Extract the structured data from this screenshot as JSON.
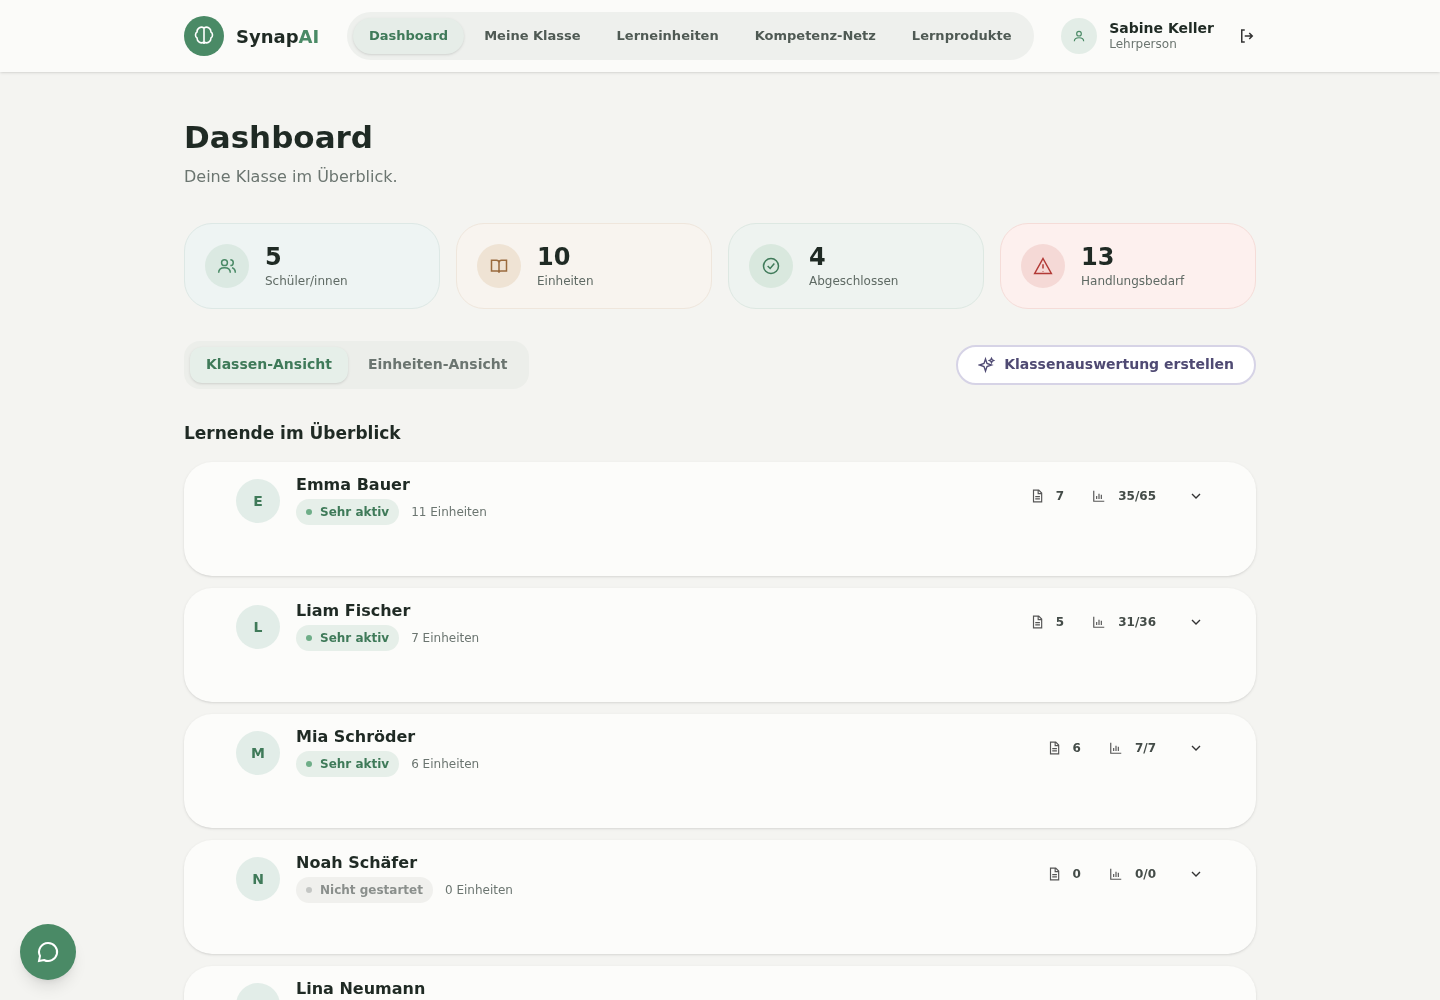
{
  "brand": {
    "name_part1": "Synap",
    "name_part2": "AI"
  },
  "nav": [
    {
      "label": "Dashboard",
      "selected": true
    },
    {
      "label": "Meine Klasse",
      "selected": false
    },
    {
      "label": "Lerneinheiten",
      "selected": false
    },
    {
      "label": "Kompetenz-Netz",
      "selected": false
    },
    {
      "label": "Lernprodukte",
      "selected": false
    }
  ],
  "user": {
    "name": "Sabine Keller",
    "role": "Lehrperson"
  },
  "page": {
    "title": "Dashboard",
    "subtitle": "Deine Klasse im Überblick."
  },
  "stats": [
    {
      "kind": "students",
      "value": "5",
      "label": "Schüler/innen"
    },
    {
      "kind": "units",
      "value": "10",
      "label": "Einheiten"
    },
    {
      "kind": "done",
      "value": "4",
      "label": "Abgeschlossen"
    },
    {
      "kind": "alert",
      "value": "13",
      "label": "Handlungsbedarf"
    }
  ],
  "view_tabs": [
    {
      "label": "Klassen-Ansicht",
      "selected": true
    },
    {
      "label": "Einheiten-Ansicht",
      "selected": false
    }
  ],
  "report_button": "Klassenauswertung erstellen",
  "section_title": "Lernende im Überblick",
  "students": [
    {
      "initial": "E",
      "name": "Emma Bauer",
      "status": "Sehr aktiv",
      "kind": "active",
      "units": "11 Einheiten",
      "docs": "7",
      "score": "35/65",
      "expanded": false
    },
    {
      "initial": "L",
      "name": "Liam Fischer",
      "status": "Sehr aktiv",
      "kind": "active",
      "units": "7 Einheiten",
      "docs": "5",
      "score": "31/36",
      "expanded": false
    },
    {
      "initial": "M",
      "name": "Mia Schröder",
      "status": "Sehr aktiv",
      "kind": "active",
      "units": "6 Einheiten",
      "docs": "6",
      "score": "7/7",
      "expanded": false
    },
    {
      "initial": "N",
      "name": "Noah Schäfer",
      "status": "Nicht gestartet",
      "kind": "inactive",
      "units": "0 Einheiten",
      "docs": "0",
      "score": "0/0",
      "expanded": false
    },
    {
      "name": "Lina Neumann",
      "kind": "cut"
    }
  ]
}
